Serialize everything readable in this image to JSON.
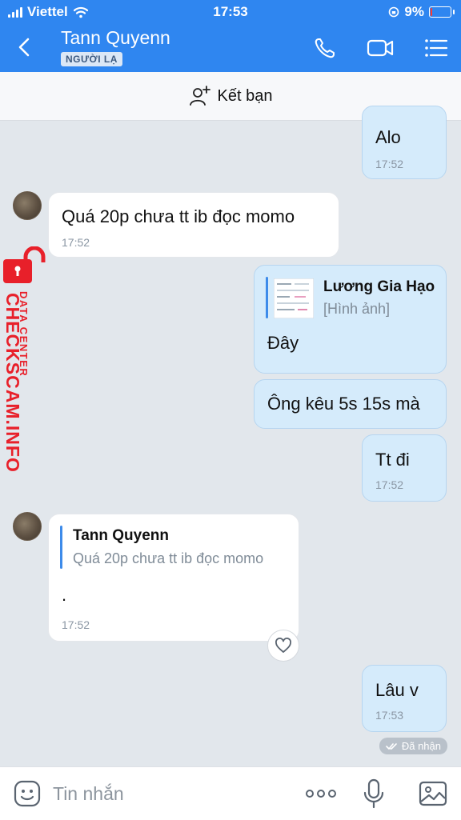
{
  "status": {
    "carrier": "Viettel",
    "time": "17:53",
    "battery": "9%",
    "battery_level": 0.09
  },
  "header": {
    "name": "Tann Quyenn",
    "badge": "NGƯỜI LẠ"
  },
  "add_friend": {
    "label": "Kết bạn"
  },
  "watermark": {
    "line1": "DATA CENTER",
    "line2": "CHECKSCAM.INFO"
  },
  "messages": [
    {
      "text": "Alo",
      "time": "17:52"
    },
    {
      "text": "Quá 20p chưa tt ib đọc momo",
      "time": "17:52"
    },
    {
      "quote_name": "Lương Gia Hạo",
      "quote_text": "[Hình ảnh]",
      "text": "Đây"
    },
    {
      "text": "Ông kêu 5s 15s mà"
    },
    {
      "text": "Tt đi",
      "time": "17:52"
    },
    {
      "quote_name": "Tann Quyenn",
      "quote_text": "Quá 20p chưa tt ib đọc momo",
      "text": ".",
      "time": "17:52"
    },
    {
      "text": "Lâu v",
      "time": "17:53"
    }
  ],
  "received_label": "Đã nhận",
  "composer": {
    "placeholder": "Tin nhắn"
  },
  "icons": [
    "signal-icon",
    "wifi-icon",
    "battery-icon",
    "back-icon",
    "phone-icon",
    "video-icon",
    "menu-icon",
    "add-friend-icon",
    "heart-icon",
    "check-icon",
    "sticker-icon",
    "more-icon",
    "mic-icon",
    "image-icon"
  ],
  "colors": {
    "header": "#2f86f0",
    "out_bubble": "#d5ebfb",
    "in_bubble": "#ffffff",
    "background": "#e2e7ec",
    "watermark": "#e8202a"
  }
}
